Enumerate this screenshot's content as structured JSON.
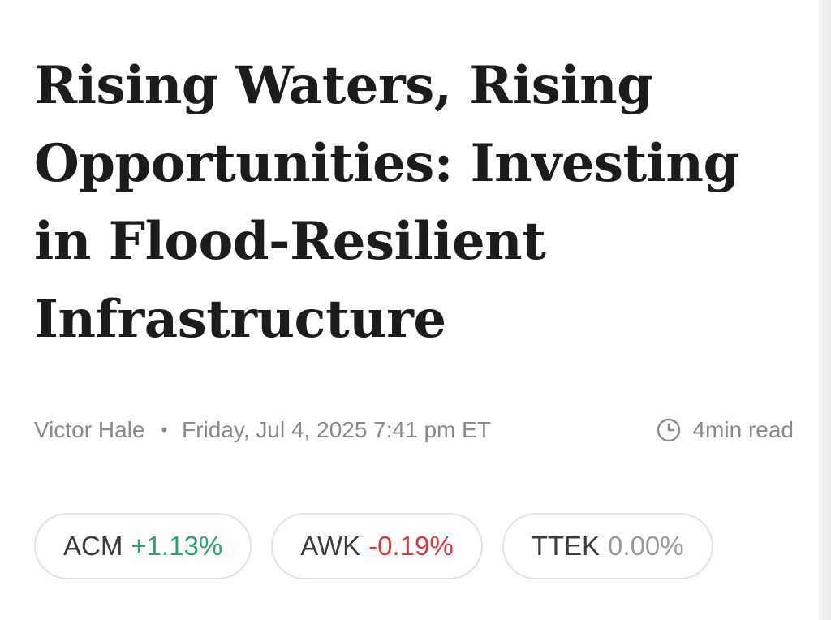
{
  "article": {
    "headline": "Rising Waters, Rising Opportunities: Investing in Flood-Resilient Infrastructure",
    "author": "Victor Hale",
    "separator": "•",
    "datetime": "Friday, Jul 4, 2025 7:41 pm ET",
    "read_time": "4min read",
    "read_time_icon": "clock-icon"
  },
  "tickers": [
    {
      "symbol": "ACM",
      "change": "+1.13%",
      "direction": "up"
    },
    {
      "symbol": "AWK",
      "change": "-0.19%",
      "direction": "down"
    },
    {
      "symbol": "TTEK",
      "change": "0.00%",
      "direction": "flat"
    }
  ],
  "colors": {
    "headline": "#1c1c1c",
    "meta": "#8a8a8a",
    "up": "#2aa37a",
    "down": "#e0353b",
    "flat": "#9a9a9a",
    "pill_border": "#e3e3e3"
  }
}
